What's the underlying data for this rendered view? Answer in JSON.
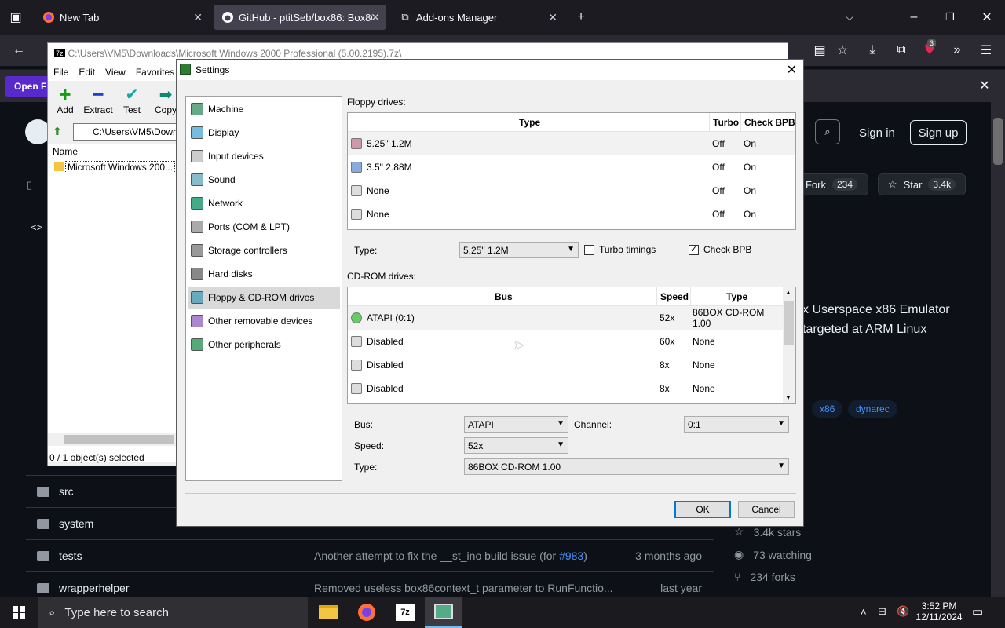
{
  "browser": {
    "tabs": [
      {
        "title": "New Tab"
      },
      {
        "title": "GitHub - ptitSeb/box86: Box86"
      },
      {
        "title": "Add-ons Manager"
      }
    ],
    "notification_partial": "Open Fi",
    "ext_badge": "3"
  },
  "github": {
    "fork_label": "Fork",
    "fork_count": "234",
    "star_label": "Star",
    "star_count": "3.4k",
    "sign_in": "Sign in",
    "sign_up": "Sign up",
    "desc_line1": "x Userspace x86 Emulator",
    "desc_line2": "targeted at ARM Linux",
    "topics": [
      "x86",
      "dynarec"
    ],
    "files": [
      {
        "name": "src",
        "msg": "",
        "time": ""
      },
      {
        "name": "system",
        "msg": "",
        "time": ""
      },
      {
        "name": "tests",
        "msg": "Another attempt to fix the __st_ino build issue (for ",
        "link": "#983",
        "msg_end": ")",
        "time": "3 months ago"
      },
      {
        "name": "wrapperhelper",
        "msg": "Removed useless box86context_t parameter to RunFunctio...",
        "time": "last year"
      }
    ],
    "stats": [
      {
        "icon": "star-icon",
        "text": "3.4k stars"
      },
      {
        "icon": "eye-icon",
        "text": "73 watching"
      },
      {
        "icon": "fork-icon",
        "text": "234 forks"
      }
    ]
  },
  "zip": {
    "title": "C:\\Users\\VM5\\Downloads\\Microsoft Windows 2000 Professional (5.00.2195).7z\\",
    "menu": [
      "File",
      "Edit",
      "View",
      "Favorites"
    ],
    "toolbar": [
      "Add",
      "Extract",
      "Test",
      "Copy"
    ],
    "path": "C:\\Users\\VM5\\Down",
    "column_name": "Name",
    "item": "Microsoft Windows 200...",
    "status": "0 / 1 object(s) selected"
  },
  "settings": {
    "title": "Settings",
    "nav": [
      {
        "label": "Machine"
      },
      {
        "label": "Display"
      },
      {
        "label": "Input devices"
      },
      {
        "label": "Sound"
      },
      {
        "label": "Network"
      },
      {
        "label": "Ports (COM & LPT)"
      },
      {
        "label": "Storage controllers"
      },
      {
        "label": "Hard disks"
      },
      {
        "label": "Floppy & CD-ROM drives"
      },
      {
        "label": "Other removable devices"
      },
      {
        "label": "Other peripherals"
      }
    ],
    "selected_nav": "Floppy & CD-ROM drives",
    "floppy_label": "Floppy drives:",
    "floppy_headers": {
      "type": "Type",
      "turbo": "Turbo",
      "checkbpb": "Check BPB"
    },
    "floppy_rows": [
      {
        "type": "5.25\" 1.2M",
        "turbo": "Off",
        "checkbpb": "On"
      },
      {
        "type": "3.5\" 2.88M",
        "turbo": "Off",
        "checkbpb": "On"
      },
      {
        "type": "None",
        "turbo": "Off",
        "checkbpb": "On"
      },
      {
        "type": "None",
        "turbo": "Off",
        "checkbpb": "On"
      }
    ],
    "floppy_type_label": "Type:",
    "floppy_type_value": "5.25\" 1.2M",
    "turbo_timings": "Turbo timings",
    "turbo_checked": false,
    "check_bpb": "Check BPB",
    "check_bpb_checked": true,
    "cdrom_label": "CD-ROM drives:",
    "cdrom_headers": {
      "bus": "Bus",
      "speed": "Speed",
      "type": "Type"
    },
    "cdrom_rows": [
      {
        "bus": "ATAPI (0:1)",
        "speed": "52x",
        "type": "86BOX CD-ROM 1.00"
      },
      {
        "bus": "Disabled",
        "speed": "60x",
        "type": "None"
      },
      {
        "bus": "Disabled",
        "speed": "8x",
        "type": "None"
      },
      {
        "bus": "Disabled",
        "speed": "8x",
        "type": "None"
      }
    ],
    "bus_label": "Bus:",
    "bus_value": "ATAPI",
    "channel_label": "Channel:",
    "channel_value": "0:1",
    "speed_label": "Speed:",
    "speed_value": "52x",
    "type_label": "Type:",
    "type_value": "86BOX CD-ROM 1.00",
    "ok": "OK",
    "cancel": "Cancel"
  },
  "taskbar": {
    "search_placeholder": "Type here to search",
    "time": "3:52 PM",
    "date": "12/11/2024"
  }
}
